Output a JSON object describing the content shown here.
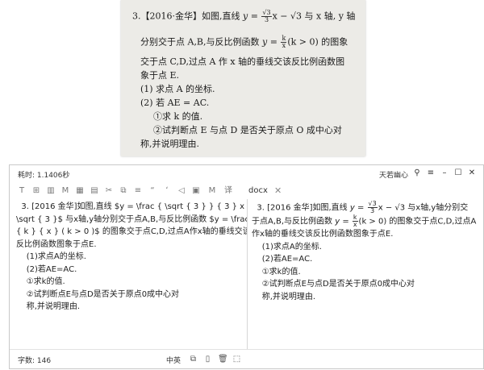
{
  "photo": {
    "lines": [
      [
        "3.【2016·金华】如图,直线 ",
        "y = ",
        "√3",
        "3",
        "x − √3 与 x 轴, y 轴"
      ],
      [
        "分别交于点 A,B,与反比例函数 ",
        "y = ",
        "k",
        "x",
        "(k > 0) 的图象"
      ],
      [
        "交于点 C,D,过点 A 作 x 轴的垂线交该反比例函数图"
      ],
      [
        "象于点 E."
      ],
      [
        "(1) 求点 A 的坐标."
      ],
      [
        "(2) 若 AE = AC."
      ],
      [
        "①求 k 的值."
      ],
      [
        "②试判断点 E 与点 D 是否关于原点 O 成中心对"
      ],
      [
        "称,并说明理由."
      ]
    ]
  },
  "window": {
    "timer": "耗时: 1.1406秒",
    "brand": "天若幽心",
    "tab_label": "docx",
    "tab_close": "✕",
    "word_count": "字数: 146",
    "lang": "中英"
  },
  "left_pane": [
    "  3. [2016 金华]如图,直线 $y = \\frac { \\sqrt { 3 } } { 3 } x -",
    "\\sqrt { 3 }$ 与x轴,y轴分别交于点A,B,与反比例函数 $y = \\frac",
    "{ k } { x } ( k > 0 )$ 的图象交于点C,D,过点A作x轴的垂线交该",
    "反比例函数图象于点E.",
    "    (1)求点A的坐标.",
    "    (2)若AE=AC.",
    "    ①求k的值.",
    "    ②试判断点E与点D是否关于原点0成中心对",
    "    称,并说明理由."
  ],
  "right_pane": {
    "line1_pre": "  3. [2016 金华]如图,直线 ",
    "line1_eq": "y = ",
    "line1_num": "√3",
    "line1_den": "3",
    "line1_post": "x − √3 与x轴,y轴分别交",
    "line2_pre": "于点A,B,与反比例函数 ",
    "line2_eq": "y = ",
    "line2_num": "k",
    "line2_den": "x",
    "line2_post": "(k > 0) 的图象交于点C,D,过点A",
    "rest": [
      "作x轴的垂线交该反比例函数图象于点E.",
      "    (1)求点A的坐标.",
      "    (2)若AE=AC.",
      "    ①求k的值.",
      "    ②试判断点E与点D是否关于原点0成中心对",
      "    称,并说明理由."
    ]
  }
}
